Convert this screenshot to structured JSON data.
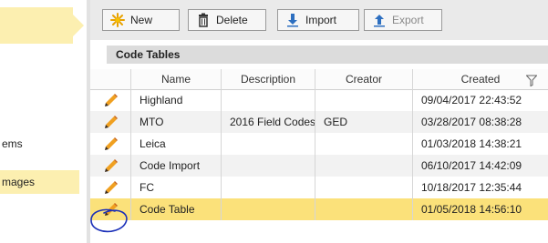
{
  "sidebar": {
    "items": [
      {
        "label": "ems",
        "active": false
      },
      {
        "label": "mages",
        "active": true
      }
    ]
  },
  "toolbar": {
    "new_label": "New",
    "delete_label": "Delete",
    "import_label": "Import",
    "export_label": "Export"
  },
  "section": {
    "title": "Code Tables"
  },
  "grid": {
    "columns": [
      "",
      "Name",
      "Description",
      "Creator",
      "Created"
    ],
    "rows": [
      {
        "name": "Highland",
        "description": "",
        "creator": "",
        "created": "09/04/2017 22:43:52"
      },
      {
        "name": "MTO",
        "description": "2016 Field Codes",
        "creator": "GED",
        "created": "03/28/2017 08:38:28"
      },
      {
        "name": "Leica",
        "description": "",
        "creator": "",
        "created": "01/03/2018 14:38:21"
      },
      {
        "name": "Code Import",
        "description": "",
        "creator": "",
        "created": "06/10/2017 14:42:09"
      },
      {
        "name": "FC",
        "description": "",
        "creator": "",
        "created": "10/18/2017 12:35:44"
      },
      {
        "name": "Code Table",
        "description": "",
        "creator": "",
        "created": "01/05/2018 14:56:10",
        "selected": true
      }
    ]
  },
  "colors": {
    "selection": "#fbe17a",
    "sidebar_highlight": "#fcefb0",
    "toolbar_bg": "#eaeaea",
    "annotation_circle": "#1a2fb8"
  },
  "icons": {
    "new": "star-burst-icon",
    "delete": "trash-icon",
    "import": "import-arrow-icon",
    "export": "export-arrow-icon",
    "edit": "pencil-icon",
    "filter": "filter-icon"
  }
}
